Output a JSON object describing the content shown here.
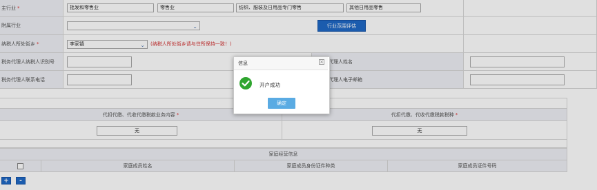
{
  "form": {
    "industry_label": "主行业",
    "industry_values": [
      "批发和零售业",
      "零售业",
      "纺织、服装及日用品专门零售",
      "其他日用品零售"
    ],
    "sub_industry_label": "附属行业",
    "sub_industry_value": "",
    "scope_button": "行业范围评估",
    "street_label": "纳税人所处街乡",
    "street_value": "李家镇",
    "street_note": "(纳税人所处街乡请与住所保持一致！)",
    "agent_id_label": "税务代理人纳税人识别号",
    "agent_id_value": "",
    "agent_name_label": "代理人姓名",
    "agent_name_value": "",
    "agent_phone_label": "税务代理人联系电话",
    "agent_phone_value": "",
    "agent_email_label": "代理人电子邮箱",
    "agent_email_value": "",
    "required_mark": "*"
  },
  "withholding": {
    "content_label": "代扣代缴、代收代缴税款业务内容",
    "tax_type_label": "代扣代缴、代收代缴税款税种",
    "content_value": "无",
    "tax_type_value": "无"
  },
  "family": {
    "section_title": "家庭经营信息",
    "columns": [
      "家庭成员姓名",
      "家庭成员身份证件种类",
      "家庭成员证件号码"
    ]
  },
  "row_buttons": {
    "add": "+",
    "remove": "-"
  },
  "dialog": {
    "title": "信息",
    "message": "开户成功",
    "confirm": "确定",
    "close_glyph": "×"
  },
  "colors": {
    "accent": "#1f69c6",
    "success": "#2fa52f",
    "confirm": "#5aabe3",
    "required": "#d33333"
  }
}
